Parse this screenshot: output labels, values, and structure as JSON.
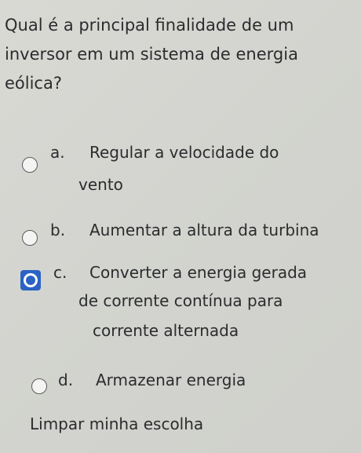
{
  "question": {
    "line1": "Qual é a principal finalidade de um",
    "line2": "inversor em um sistema de energia",
    "line3": "eólica?"
  },
  "options": [
    {
      "letter": "a.",
      "line1": "Regular a velocidade do",
      "line2": "vento",
      "selected": false
    },
    {
      "letter": "b.",
      "line1": "Aumentar a altura da turbina",
      "selected": false
    },
    {
      "letter": "c.",
      "line1": "Converter a energia gerada",
      "line2": "de corrente contínua para",
      "line3": "corrente alternada",
      "selected": true
    },
    {
      "letter": "d.",
      "line1": "Armazenar energia",
      "selected": false
    }
  ],
  "clear_label": "Limpar minha escolha",
  "colors": {
    "accent": "#2b63c4",
    "background": "#d5d6d1",
    "text": "#2b2c2e"
  }
}
